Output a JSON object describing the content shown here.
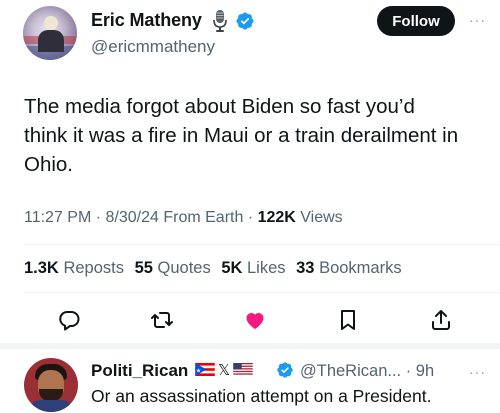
{
  "tweet": {
    "author": {
      "display_name": "Eric Matheny",
      "handle": "@ericmmatheny",
      "badge_icon": "microphone-icon",
      "verified_icon": "verified-badge-icon"
    },
    "follow_label": "Follow",
    "more_label": "···",
    "text": "The media forgot about Biden so fast you’d\nthink it was a fire in Maui or a train derailment in\nOhio.",
    "meta": {
      "time": "11:27 PM",
      "sep1": " · ",
      "date": "8/30/24",
      "source": " From Earth",
      "sep2": " · ",
      "views_count": "122K",
      "views_label": " Views"
    },
    "stats": {
      "reposts_count": "1.3K",
      "reposts_label": " Reposts",
      "quotes_count": "55",
      "quotes_label": " Quotes",
      "likes_count": "5K",
      "likes_label": " Likes",
      "bookmarks_count": "33",
      "bookmarks_label": " Bookmarks"
    },
    "actions": [
      "reply-icon",
      "repost-icon",
      "like-icon-filled",
      "bookmark-icon",
      "share-icon"
    ],
    "like_color": "#f91880"
  },
  "reply": {
    "display_name": "Politi_Rican",
    "flags": [
      "puerto-rico-flag-icon",
      "x-logo-icon",
      "us-flag-icon"
    ],
    "x_glyph": "𝕏",
    "handle": "@TheRican...",
    "sep": " · ",
    "time": "9h",
    "more_label": "···",
    "text": "Or an assassination attempt on a President."
  },
  "colors": {
    "verified_blue": "#1d9bf0",
    "muted_text": "#536471",
    "primary_text": "#0f1419"
  }
}
